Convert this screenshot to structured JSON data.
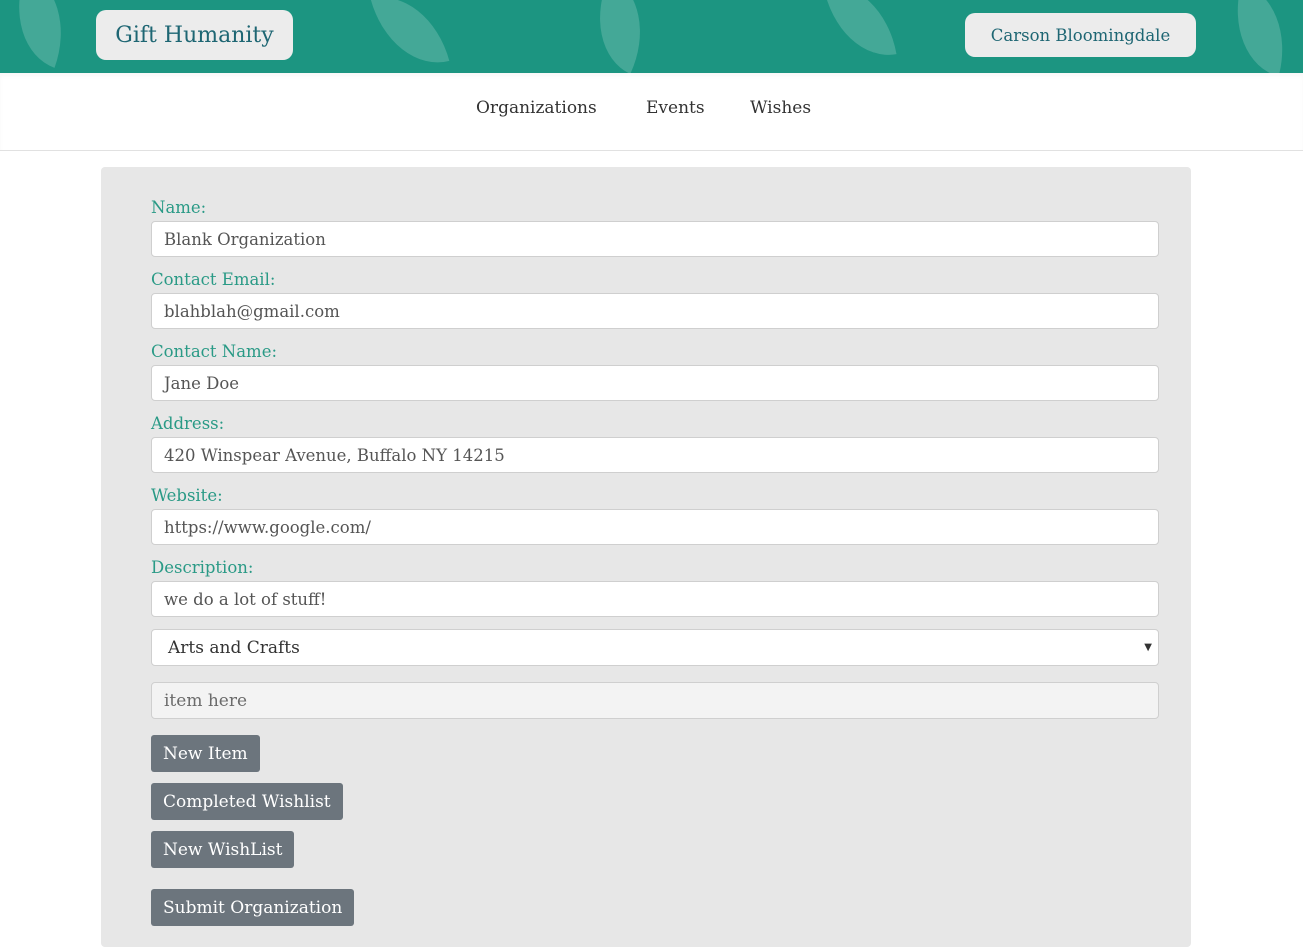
{
  "header": {
    "brand": "Gift Humanity",
    "user": "Carson Bloomingdale",
    "background_color": "#1c9581"
  },
  "nav": {
    "items": [
      {
        "label": "Organizations"
      },
      {
        "label": "Events"
      },
      {
        "label": "Wishes"
      }
    ]
  },
  "form": {
    "fields": [
      {
        "label": "Name:",
        "value": "Blank Organization"
      },
      {
        "label": "Contact Email:",
        "value": "blahblah@gmail.com"
      },
      {
        "label": "Contact Name:",
        "value": "Jane Doe"
      },
      {
        "label": "Address:",
        "value": "420 Winspear Avenue, Buffalo NY 14215"
      },
      {
        "label": "Website:",
        "value": "https://www.google.com/"
      },
      {
        "label": "Description:",
        "value": "we do a lot of stuff!"
      }
    ],
    "category_selected": "Arts and Crafts",
    "item_placeholder": "item here",
    "buttons": {
      "new_item": "New Item",
      "completed_wishlist": "Completed Wishlist",
      "new_wishlist": "New WishList",
      "submit": "Submit Organization"
    },
    "accent_color": "#2a9a86",
    "button_color": "#6c757d"
  }
}
